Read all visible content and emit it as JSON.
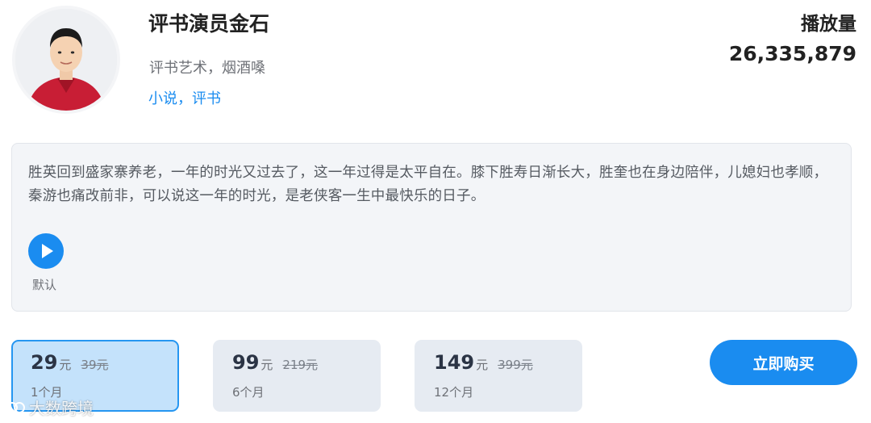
{
  "header": {
    "name": "评书演员金石",
    "subtitle": "评书艺术，烟酒嗓",
    "tags": "小说，评书",
    "plays_label": "播放量",
    "plays_value": "26,335,879"
  },
  "description": {
    "text": "胜英回到盛家寨养老，一年的时光又过去了，这一年过得是太平自在。膝下胜寿日渐长大，胜奎也在身边陪伴，儿媳妇也孝顺，秦游也痛改前非，可以说这一年的时光，是老侠客一生中最快乐的日子。",
    "voice_label": "默认"
  },
  "plans": [
    {
      "price": "29",
      "unit": "元",
      "original": "39元",
      "period": "1个月",
      "selected": true
    },
    {
      "price": "99",
      "unit": "元",
      "original": "219元",
      "period": "6个月",
      "selected": false
    },
    {
      "price": "149",
      "unit": "元",
      "original": "399元",
      "period": "12个月",
      "selected": false
    }
  ],
  "buy_button": "立即购买",
  "watermark": "大数跨境",
  "colors": {
    "accent": "#1a8cf0",
    "selected_plan_bg": "#c4e2fb",
    "plan_bg": "#e6ebf2",
    "desc_bg": "#f3f5f8"
  },
  "icons": {
    "play": "play-icon",
    "avatar": "avatar-photo"
  }
}
